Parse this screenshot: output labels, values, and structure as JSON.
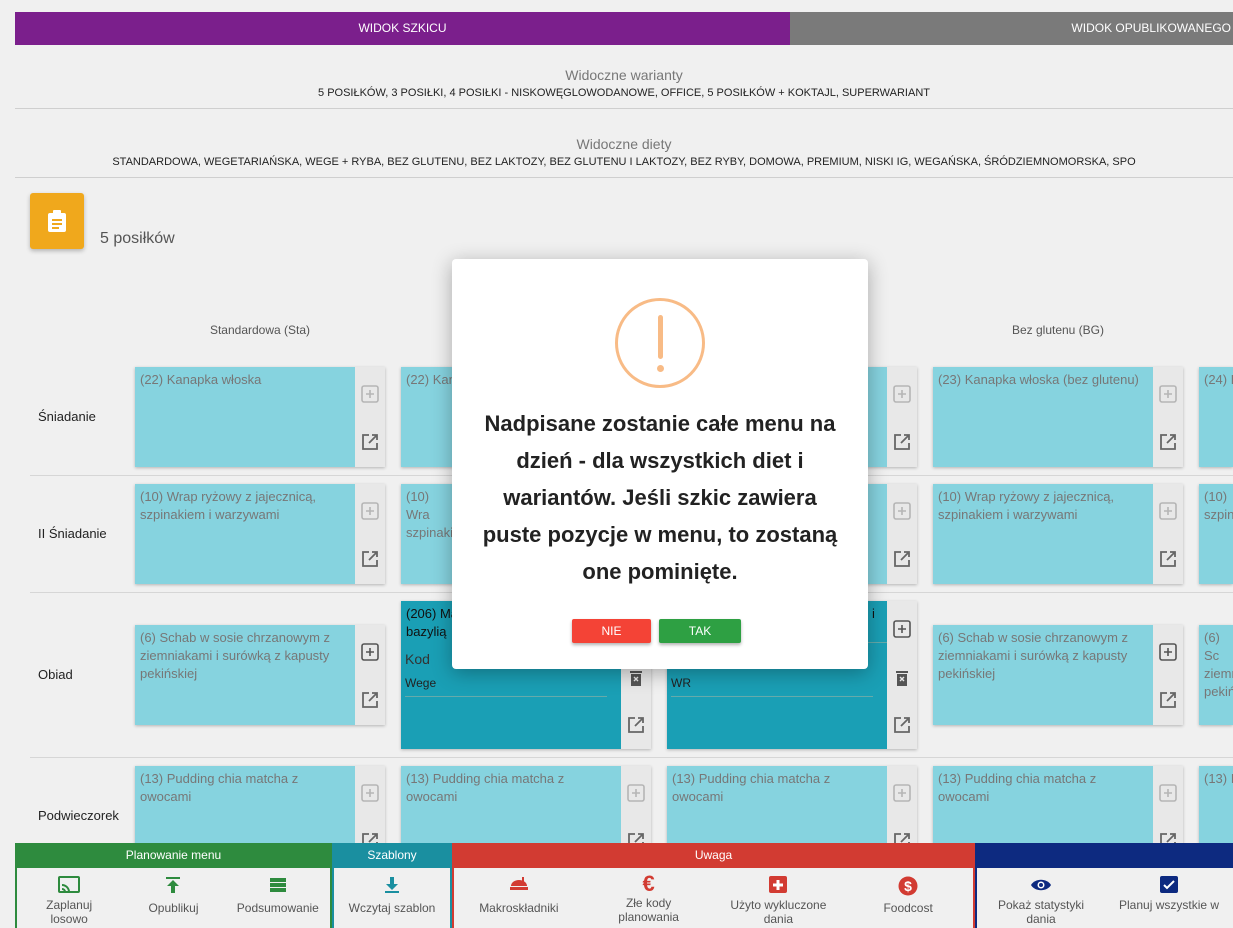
{
  "tabs": {
    "draft": "WIDOK SZKICU",
    "published": "WIDOK OPUBLIKOWANEGO"
  },
  "visible_variants": {
    "title": "Widoczne warianty",
    "list": "5 POSIŁKÓW, 3 POSIŁKI, 4 POSIŁKI - NISKOWĘGLOWODANOWE, OFFICE, 5 POSIŁKÓW + KOKTAJL, SUPERWARIANT"
  },
  "visible_diets": {
    "title": "Widoczne diety",
    "list": "STANDARDOWA, WEGETARIAŃSKA, WEGE + RYBA, BEZ GLUTENU, BEZ LAKTOZY, BEZ GLUTENU I LAKTOZY, BEZ RYBY, DOMOWA, PREMIUM, NISKI IG, WEGAŃSKA, ŚRÓDZIEMNOMORSKA, SPO"
  },
  "menu_title": "5 posiłków",
  "columns": [
    "Standardowa (Sta)",
    "Bez glutenu (BG)"
  ],
  "rows": [
    "Śniadanie",
    "II Śniadanie",
    "Obiad",
    "Podwieczorek"
  ],
  "cards": {
    "r1c1": "(22) Kanapka włoska",
    "r1c2": "(22) Kan",
    "r1c4": "(23) Kanapka włoska (bez glutenu)",
    "r1c5": "(24) K",
    "r2c1": "(10) Wrap ryżowy z jajecznicą, szpinakiem i warzywami",
    "r2c2": "(10) Wra szpinaki",
    "r2c4": "(10) Wrap ryżowy z jajecznicą, szpinakiem i warzywami",
    "r2c5": "(10) szpin",
    "r3c1": "(6) Schab w sosie chrzanowym z ziemniakami i surówką z kapusty pekińskiej",
    "r3c2_title": "(206) Ma bazylią",
    "r3c2_code_label": "Kod",
    "r3c2_code_value": "Wege",
    "r3c3_title": "i",
    "r3c3_code_value": "WR",
    "r3c4": "(6) Schab w sosie chrzanowym z ziemniakami i surówką z kapusty pekińskiej",
    "r3c5": "(6) Sc ziemn pekiń",
    "r4c1": "(13) Pudding chia matcha z owocami",
    "r4c2": "(13) Pudding chia matcha z owocami",
    "r4c3": "(13) Pudding chia matcha z owocami",
    "r4c4": "(13) Pudding chia matcha z owocami",
    "r4c5": "(13) I"
  },
  "modal": {
    "message": "Nadpisane zostanie całe menu na dzień - dla wszystkich diet i wariantów. Jeśli szkic zawiera puste pozycje w menu, to zostaną one pominięte.",
    "no": "NIE",
    "yes": "TAK"
  },
  "bottom_bar": {
    "planning": {
      "title": "Planowanie menu",
      "items": [
        "Zaplanuj losowo",
        "Opublikuj",
        "Podsumowanie"
      ]
    },
    "templates": {
      "title": "Szablony",
      "items": [
        "Wczytaj szablon"
      ]
    },
    "warning": {
      "title": "Uwaga",
      "items": [
        "Makroskładniki",
        "Złe kody planowania",
        "Użyto wykluczone dania",
        "Foodcost"
      ]
    },
    "view": {
      "title": "",
      "items": [
        "Pokaż statystyki dania",
        "Planuj wszystkie warianty"
      ]
    }
  },
  "colors": {
    "draft_tab": "#7b1f8c",
    "published_tab": "#7a7a7a",
    "planning": "#2e8b3e",
    "templates": "#1a8fa0",
    "warning": "#d23b32",
    "view": "#0d2a80",
    "card": "#86d3df",
    "card_selected": "#1a9fb5",
    "badge": "#f0a81c"
  }
}
